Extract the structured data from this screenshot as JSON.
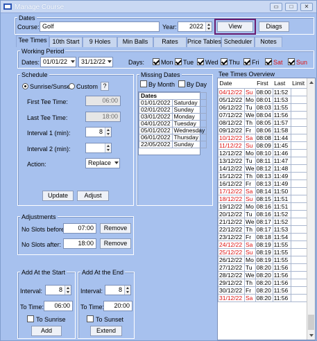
{
  "window": {
    "title": "Manage Course"
  },
  "dates_group": {
    "label": "Dates",
    "course_label": "Course:",
    "course_value": "Golf",
    "year_label": "Year:",
    "year_value": "2022",
    "view_button": "View",
    "diags_button": "Diags"
  },
  "tabs": [
    "Tee Times",
    "10th Start",
    "9 Holes",
    "Min Balls",
    "Rates",
    "Price Tables",
    "Scheduler",
    "Notes"
  ],
  "working_period": {
    "label": "Working Period",
    "dates_label": "Dates:",
    "from": "01/01/22",
    "to": "31/12/22",
    "days_label": "Days:",
    "days": [
      {
        "label": "Mon",
        "checked": true,
        "color": "#000080"
      },
      {
        "label": "Tue",
        "checked": true,
        "color": "#000080"
      },
      {
        "label": "Wed",
        "checked": true,
        "color": "#000080"
      },
      {
        "label": "Thu",
        "checked": true,
        "color": "#000080"
      },
      {
        "label": "Fri",
        "checked": true,
        "color": "#000080"
      },
      {
        "label": "Sat",
        "checked": true,
        "color": "#dd1111"
      },
      {
        "label": "Sun",
        "checked": true,
        "color": "#dd1111"
      }
    ]
  },
  "schedule": {
    "label": "Schedule",
    "radio_sunrise": "Sunrise/Sunset",
    "radio_custom": "Custom",
    "help": "?",
    "first_tee_label": "First Tee Time:",
    "first_tee_value": "06:00",
    "last_tee_label": "Last Tee Time:",
    "last_tee_value": "18:00",
    "interval1_label": "Interval 1 (min):",
    "interval1_value": "8",
    "interval2_label": "Interval 2 (min):",
    "interval2_value": "",
    "action_label": "Action:",
    "action_value": "Replace",
    "update_button": "Update",
    "adjust_button": "Adjust"
  },
  "missing_dates": {
    "label": "Missing Dates",
    "by_month": "By Month",
    "by_day": "By Day",
    "header": "Dates",
    "rows": [
      [
        "01/01/2022",
        "Saturday"
      ],
      [
        "02/01/2022",
        "Sunday"
      ],
      [
        "03/01/2022",
        "Monday"
      ],
      [
        "04/01/2022",
        "Tuesday"
      ],
      [
        "05/01/2022",
        "Wednesday"
      ],
      [
        "06/01/2022",
        "Thursday"
      ],
      [
        "22/05/2022",
        "Sunday"
      ]
    ]
  },
  "adjustments": {
    "label": "Adjustments",
    "no_slots_before_label": "No Slots before:",
    "no_slots_before_value": "07:00",
    "no_slots_after_label": "No Slots after:",
    "no_slots_after_value": "18:00",
    "remove_label": "Remove"
  },
  "add_start": {
    "label": "Add At the Start",
    "interval_label": "Interval:",
    "interval_value": "8",
    "to_time_label": "To Time:",
    "to_time_value": "06:00",
    "to_check": "To Sunrise",
    "button": "Add"
  },
  "add_end": {
    "label": "Add At the End",
    "interval_label": "Interval:",
    "interval_value": "8",
    "to_time_label": "To Time:",
    "to_time_value": "20:00",
    "to_check": "To Sunset",
    "button": "Extend"
  },
  "tee_overview": {
    "label": "Tee Times Overview",
    "headers": [
      "Date",
      "",
      "First",
      "Last",
      "Limit"
    ],
    "rows": [
      [
        "04/12/22",
        "Su",
        "08:00",
        "11:52",
        "",
        true
      ],
      [
        "05/12/22",
        "Mo",
        "08:01",
        "11:53",
        "",
        false
      ],
      [
        "06/12/22",
        "Tu",
        "08:03",
        "11:55",
        "",
        false
      ],
      [
        "07/12/22",
        "We",
        "08:04",
        "11:56",
        "",
        false
      ],
      [
        "08/12/22",
        "Th",
        "08:05",
        "11:57",
        "",
        false
      ],
      [
        "09/12/22",
        "Fr",
        "08:06",
        "11:58",
        "",
        false
      ],
      [
        "10/12/22",
        "Sa",
        "08:08",
        "11:44",
        "",
        true
      ],
      [
        "11/12/22",
        "Su",
        "08:09",
        "11:45",
        "",
        true
      ],
      [
        "12/12/22",
        "Mo",
        "08:10",
        "11:46",
        "",
        false
      ],
      [
        "13/12/22",
        "Tu",
        "08:11",
        "11:47",
        "",
        false
      ],
      [
        "14/12/22",
        "We",
        "08:12",
        "11:48",
        "",
        false
      ],
      [
        "15/12/22",
        "Th",
        "08:13",
        "11:49",
        "",
        false
      ],
      [
        "16/12/22",
        "Fr",
        "08:13",
        "11:49",
        "",
        false
      ],
      [
        "17/12/22",
        "Sa",
        "08:14",
        "11:50",
        "",
        true
      ],
      [
        "18/12/22",
        "Su",
        "08:15",
        "11:51",
        "",
        true
      ],
      [
        "19/12/22",
        "Mo",
        "08:16",
        "11:51",
        "",
        false
      ],
      [
        "20/12/22",
        "Tu",
        "08:16",
        "11:52",
        "",
        false
      ],
      [
        "21/12/22",
        "We",
        "08:17",
        "11:52",
        "",
        false
      ],
      [
        "22/12/22",
        "Th",
        "08:17",
        "11:53",
        "",
        false
      ],
      [
        "23/12/22",
        "Fr",
        "08:18",
        "11:54",
        "",
        false
      ],
      [
        "24/12/22",
        "Sa",
        "08:19",
        "11:55",
        "",
        true
      ],
      [
        "25/12/22",
        "Su",
        "08:19",
        "11:55",
        "",
        true
      ],
      [
        "26/12/22",
        "Mo",
        "08:19",
        "11:55",
        "",
        false
      ],
      [
        "27/12/22",
        "Tu",
        "08:20",
        "11:56",
        "",
        false
      ],
      [
        "28/12/22",
        "We",
        "08:20",
        "11:56",
        "",
        false
      ],
      [
        "29/12/22",
        "Th",
        "08:20",
        "11:56",
        "",
        false
      ],
      [
        "30/12/22",
        "Fr",
        "08:20",
        "11:56",
        "",
        false
      ],
      [
        "31/12/22",
        "Sa",
        "08:20",
        "11:56",
        "",
        true
      ]
    ]
  }
}
